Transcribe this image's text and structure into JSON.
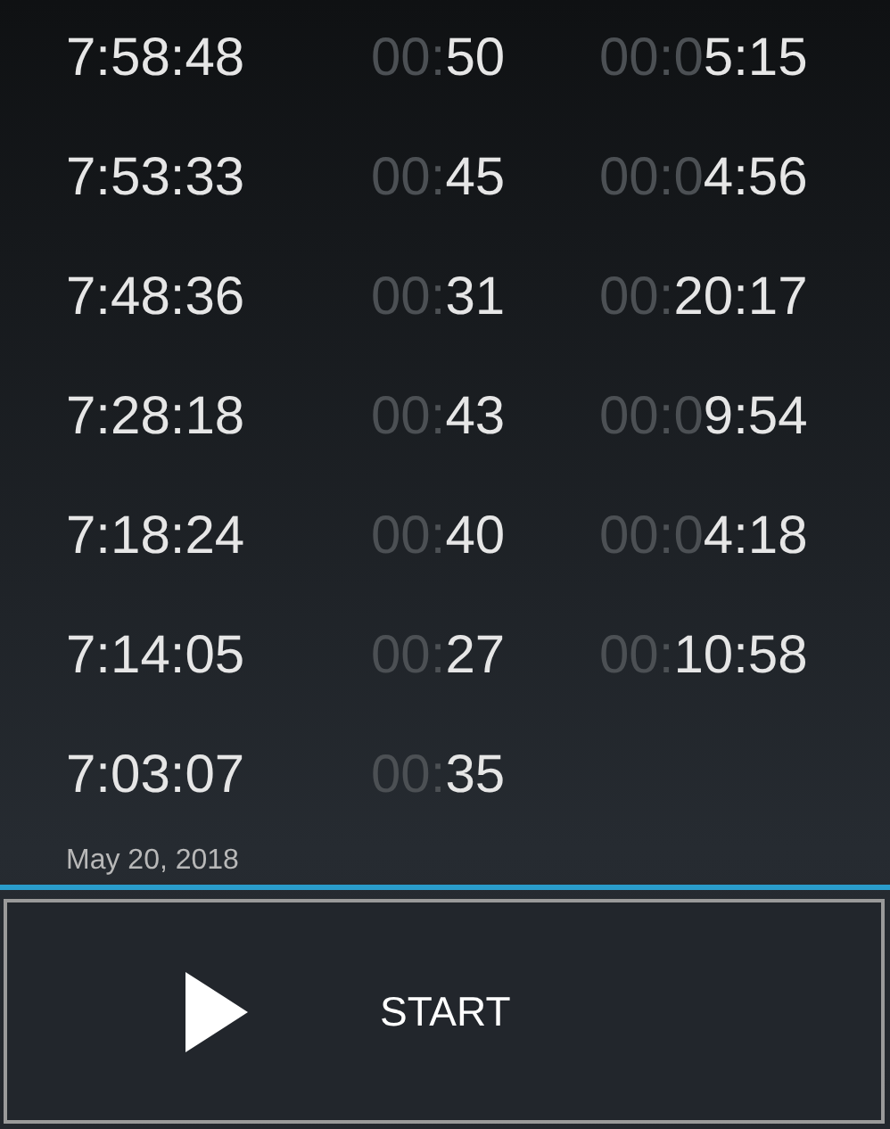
{
  "laps": [
    {
      "time": "7:58:48",
      "lap": {
        "faded": "00:",
        "shown": "50"
      },
      "total": {
        "faded": "00:0",
        "shown": "5:15"
      }
    },
    {
      "time": "7:53:33",
      "lap": {
        "faded": "00:",
        "shown": "45"
      },
      "total": {
        "faded": "00:0",
        "shown": "4:56"
      }
    },
    {
      "time": "7:48:36",
      "lap": {
        "faded": "00:",
        "shown": "31"
      },
      "total": {
        "faded": "00:",
        "shown": "20:17"
      }
    },
    {
      "time": "7:28:18",
      "lap": {
        "faded": "00:",
        "shown": "43"
      },
      "total": {
        "faded": "00:0",
        "shown": "9:54"
      }
    },
    {
      "time": "7:18:24",
      "lap": {
        "faded": "00:",
        "shown": "40"
      },
      "total": {
        "faded": "00:0",
        "shown": "4:18"
      }
    },
    {
      "time": "7:14:05",
      "lap": {
        "faded": "00:",
        "shown": "27"
      },
      "total": {
        "faded": "00:",
        "shown": "10:58"
      }
    },
    {
      "time": "7:03:07",
      "lap": {
        "faded": "00:",
        "shown": "35"
      }
    }
  ],
  "date": "May 20, 2018",
  "start_button": {
    "label": "START"
  }
}
